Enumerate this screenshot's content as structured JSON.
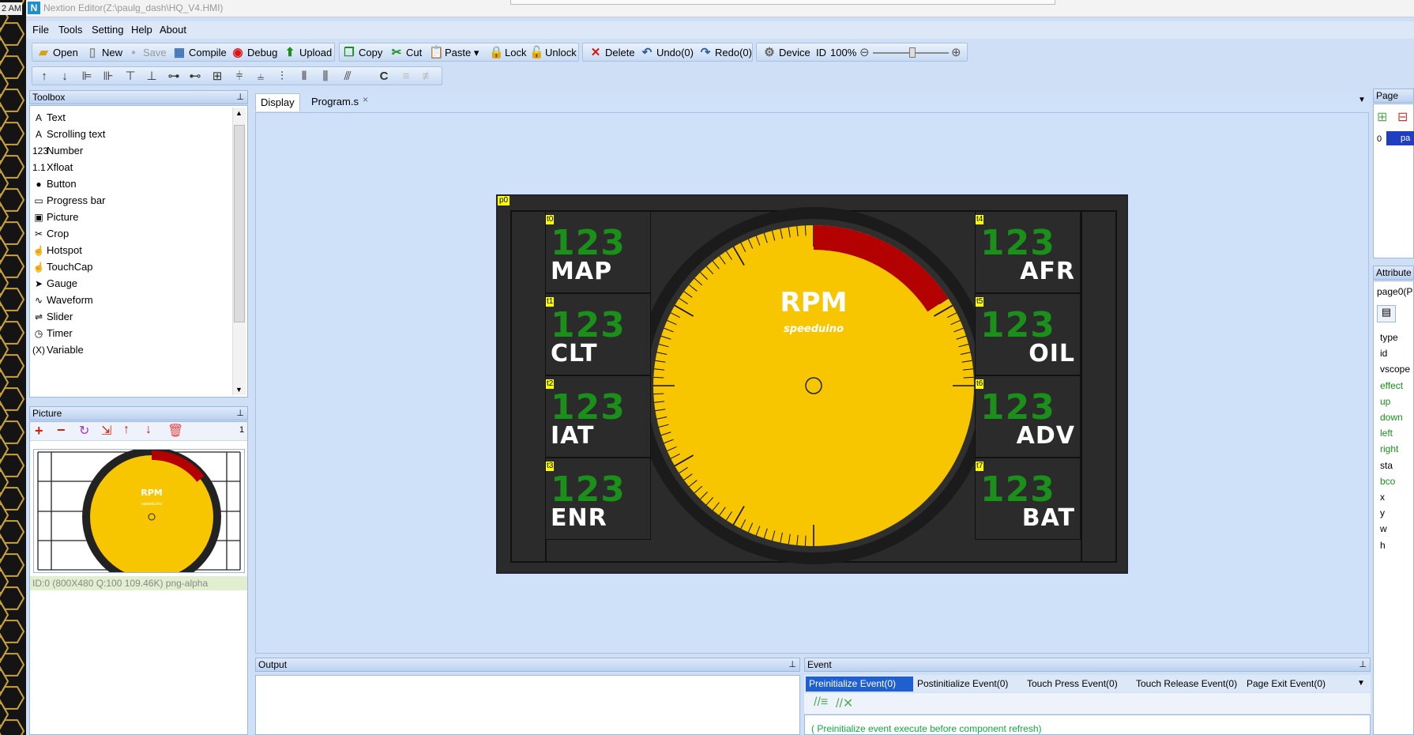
{
  "clock": "2 AM",
  "window_title": "Nextion Editor(Z:\\paulg_dash\\HQ_V4.HMI)",
  "menu": [
    "File",
    "Tools",
    "Setting",
    "Help",
    "About"
  ],
  "toolbar": {
    "open": "Open",
    "new": "New",
    "save": "Save",
    "compile": "Compile",
    "debug": "Debug",
    "upload": "Upload",
    "copy": "Copy",
    "cut": "Cut",
    "paste": "Paste",
    "lock": "Lock",
    "unlock": "Unlock",
    "delete": "Delete",
    "undo": "Undo(0)",
    "redo": "Redo(0)",
    "device": "Device",
    "id": "ID",
    "zoom": "100%",
    "c_label": "C"
  },
  "toolbox": {
    "title": "Toolbox",
    "items": [
      "Text",
      "Scrolling text",
      "Number",
      "Xfloat",
      "Button",
      "Progress bar",
      "Picture",
      "Crop",
      "Hotspot",
      "TouchCap",
      "Gauge",
      "Waveform",
      "Slider",
      "Timer",
      "Variable"
    ],
    "icons": [
      "A",
      "A",
      "123",
      "1.1",
      "●",
      "▭",
      "▣",
      "✂",
      "☝",
      "☝",
      "➤",
      "∿",
      "⇌",
      "◷",
      "(X)"
    ]
  },
  "picture_panel": {
    "title": "Picture",
    "count": "1",
    "info": "ID:0  (800X480 Q:100 109.46K) png-alpha",
    "thumb_rpm": "RPM",
    "thumb_brand": "speeduino"
  },
  "tabs": [
    "Display",
    "Program.s"
  ],
  "tab_close": "×",
  "screen": {
    "page_tag": "p0",
    "rpm_label": "RPM",
    "brand": "speeduino",
    "accent_yellow": "#f7c600",
    "redline": "#b30000",
    "number_color": "#1a8f1a",
    "left_cells": [
      {
        "tag": "t0",
        "value": "123",
        "label": "MAP"
      },
      {
        "tag": "t1",
        "value": "123",
        "label": "CLT"
      },
      {
        "tag": "t2",
        "value": "123",
        "label": "IAT"
      },
      {
        "tag": "t3",
        "value": "123",
        "label": "ENR"
      }
    ],
    "right_cells": [
      {
        "tag": "t4",
        "value": "123",
        "label": "AFR"
      },
      {
        "tag": "t5",
        "value": "123",
        "label": "OIL"
      },
      {
        "tag": "t6",
        "value": "123",
        "label": "ADV"
      },
      {
        "tag": "t7",
        "value": "123",
        "label": "BAT"
      }
    ]
  },
  "output": {
    "title": "Output"
  },
  "event": {
    "title": "Event",
    "tabs": [
      "Preinitialize Event(0)",
      "Postinitialize Event(0)",
      "Touch Press Event(0)",
      "Touch Release Event(0)",
      "Page Exit Event(0)"
    ],
    "code": "( Preinitialize event execute before component refresh)"
  },
  "page_panel": {
    "title": "Page",
    "row_index": "0",
    "row_label": "pa"
  },
  "attribute_panel": {
    "title": "Attribute",
    "selected": "page0(P",
    "fields": [
      "type",
      "id",
      "vscope",
      "effect",
      "up",
      "down",
      "left",
      "right",
      "sta",
      "bco",
      "x",
      "y",
      "w",
      "h"
    ]
  }
}
